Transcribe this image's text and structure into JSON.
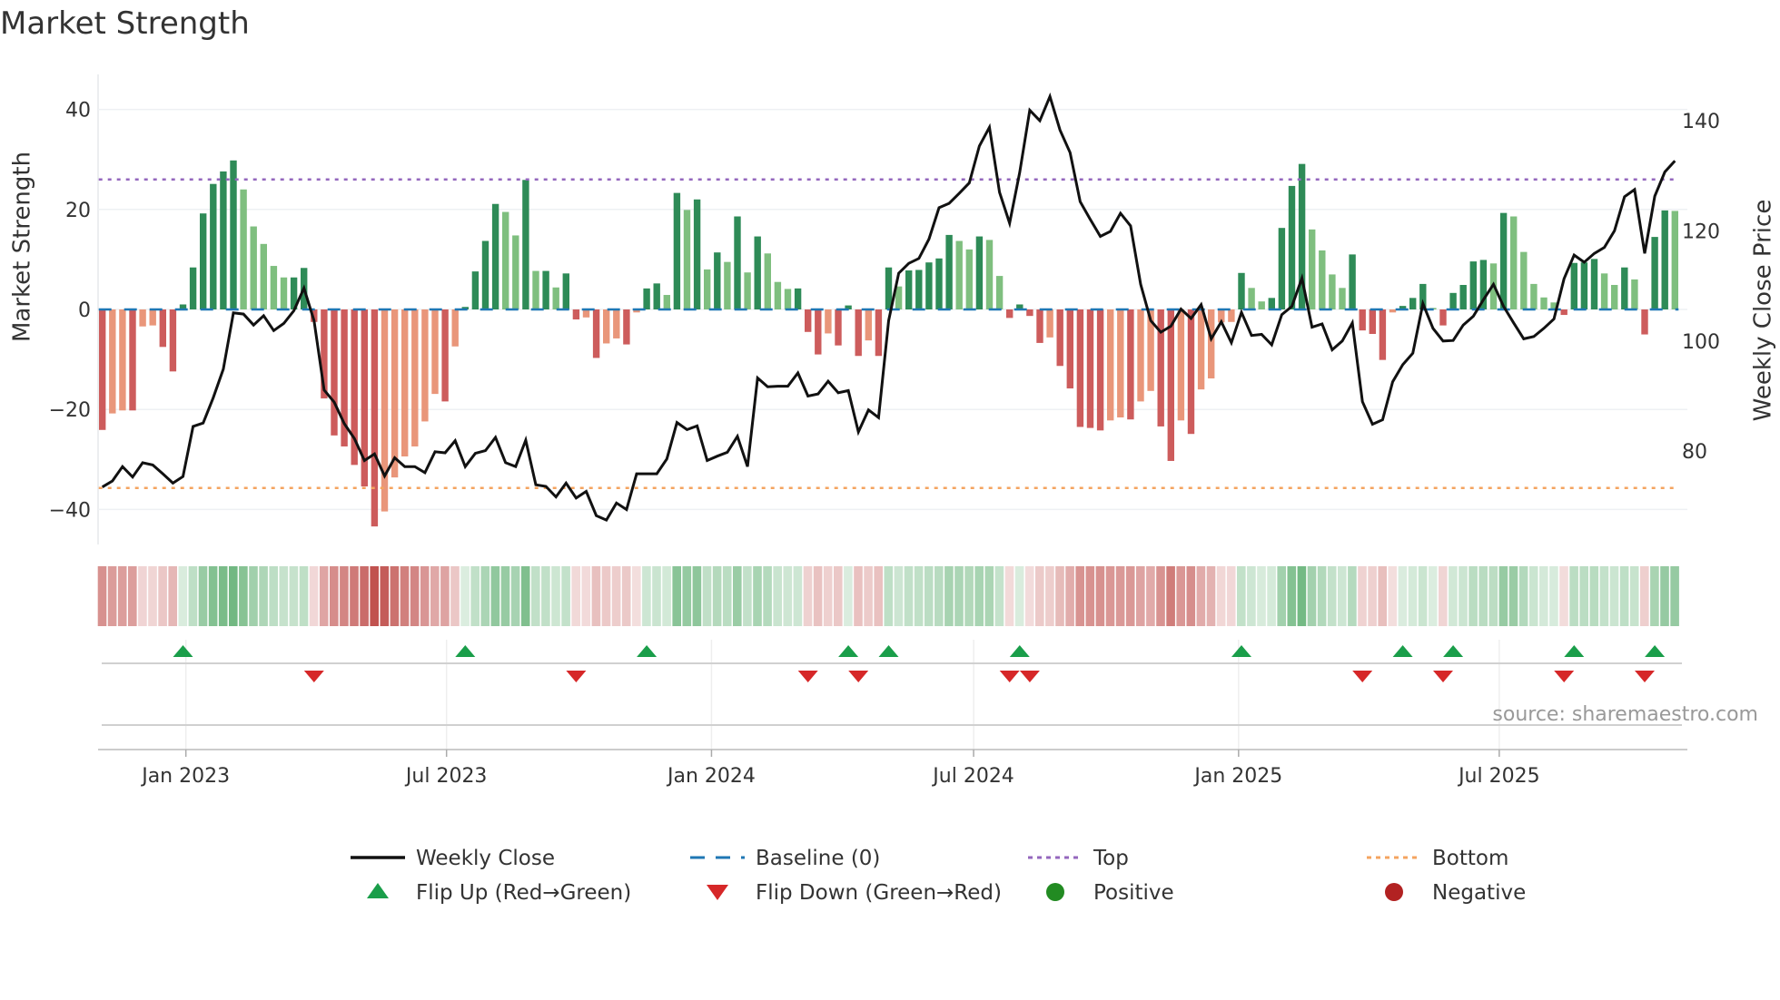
{
  "title": "Market Strength",
  "source": "source: sharemaestro.com",
  "chart_data": {
    "type": "bar+line",
    "title": "Market Strength",
    "start_week": "2022-11-04",
    "frequency": "weekly",
    "left_axis": {
      "label": "Market Strength",
      "ticks": [
        -40,
        -20,
        0,
        20,
        40
      ],
      "range": [
        -47,
        47
      ]
    },
    "right_axis": {
      "label": "Weekly Close Price",
      "ticks": [
        80,
        100,
        120,
        140
      ],
      "range": [
        63,
        148.4
      ]
    },
    "x_ticks": [
      {
        "label": "Jan 2023",
        "date": "2023-01-01"
      },
      {
        "label": "Jul 2023",
        "date": "2023-07-01"
      },
      {
        "label": "Jan 2024",
        "date": "2024-01-01"
      },
      {
        "label": "Jul 2024",
        "date": "2024-07-01"
      },
      {
        "label": "Jan 2025",
        "date": "2025-01-01"
      },
      {
        "label": "Jul 2025",
        "date": "2025-07-01"
      }
    ],
    "top_threshold": 26,
    "bottom_threshold": -35.7,
    "baseline": 0,
    "strength": [
      -24.1,
      -20.8,
      -20.2,
      -20.2,
      -3.4,
      -3.2,
      -7.5,
      -12.4,
      1.0,
      8.4,
      19.2,
      25.1,
      27.6,
      29.8,
      24.0,
      16.6,
      13.1,
      8.7,
      6.4,
      6.4,
      8.3,
      -2.5,
      -17.8,
      -25.2,
      -27.4,
      -31.1,
      -35.4,
      -43.4,
      -40.4,
      -33.6,
      -29.4,
      -27.4,
      -22.4,
      -16.9,
      -18.4,
      -7.4,
      0.5,
      7.6,
      13.7,
      21.1,
      19.5,
      14.8,
      25.9,
      7.7,
      7.7,
      4.4,
      7.2,
      -2.0,
      -1.6,
      -9.7,
      -6.8,
      -5.8,
      -7.0,
      -0.6,
      4.2,
      5.2,
      2.9,
      23.3,
      19.9,
      22.0,
      8.0,
      11.4,
      9.5,
      18.6,
      7.4,
      14.6,
      11.2,
      5.5,
      4.1,
      4.2,
      -4.5,
      -9.0,
      -4.8,
      -7.2,
      0.8,
      -9.3,
      -6.2,
      -9.3,
      8.4,
      4.6,
      7.8,
      7.9,
      9.4,
      10.2,
      14.9,
      13.7,
      12.0,
      14.6,
      13.9,
      6.7,
      -1.7,
      1.0,
      -1.3,
      -6.7,
      -5.6,
      -11.3,
      -15.8,
      -23.5,
      -23.7,
      -24.2,
      -22.2,
      -21.6,
      -22.0,
      -18.4,
      -16.3,
      -23.4,
      -30.3,
      -22.2,
      -24.9,
      -16.0,
      -13.8,
      -2.6,
      -2.5,
      7.3,
      4.3,
      1.6,
      2.3,
      16.3,
      24.7,
      29.1,
      16.0,
      11.8,
      7.0,
      4.3,
      11.0,
      -4.2,
      -4.9,
      -10.1,
      -0.6,
      0.7,
      2.3,
      5.1,
      0.3,
      -3.2,
      3.3,
      4.9,
      9.6,
      9.9,
      9.2,
      19.3,
      18.6,
      11.5,
      5.1,
      2.4,
      1.4,
      -1.1,
      9.3,
      9.4,
      10.1,
      7.2,
      4.9,
      8.4,
      6.0,
      -5.0,
      14.5,
      19.8,
      19.7
    ],
    "weekly_close": [
      73.5,
      74.6,
      77.2,
      75.3,
      77.9,
      77.5,
      75.9,
      74.2,
      75.4,
      84.5,
      85.1,
      89.7,
      94.9,
      105.1,
      104.9,
      102.9,
      104.6,
      101.9,
      103.2,
      105.5,
      109.6,
      103.7,
      91.1,
      88.9,
      85.0,
      82.3,
      78.3,
      79.5,
      75.5,
      78.8,
      77.2,
      77.2,
      76.1,
      79.9,
      79.7,
      81.9,
      77.2,
      79.6,
      80.1,
      82.5,
      77.9,
      77.2,
      82.0,
      73.9,
      73.6,
      71.7,
      74.2,
      71.5,
      72.7,
      68.3,
      67.5,
      70.6,
      69.4,
      75.9,
      75.9,
      75.9,
      78.6,
      85.2,
      83.9,
      84.6,
      78.3,
      79.1,
      79.8,
      82.7,
      77.2,
      93.3,
      91.7,
      91.8,
      91.8,
      94.2,
      90.0,
      90.4,
      92.7,
      90.6,
      91.0,
      83.5,
      87.5,
      86.1,
      103.7,
      112.3,
      114.1,
      115.0,
      118.5,
      124.2,
      125.0,
      126.8,
      128.7,
      135.4,
      138.8,
      127.0,
      121.4,
      130.6,
      141.9,
      140.0,
      144.4,
      138.3,
      134.2,
      125.3,
      122.1,
      119.0,
      119.9,
      123.2,
      120.9,
      110.3,
      103.7,
      101.6,
      102.7,
      105.8,
      104.1,
      106.6,
      100.4,
      103.5,
      99.7,
      105.2,
      101.0,
      101.2,
      99.3,
      104.8,
      106.3,
      111.4,
      102.5,
      103.1,
      98.4,
      100.0,
      103.3,
      89.0,
      84.9,
      85.7,
      92.6,
      95.7,
      97.8,
      106.8,
      102.3,
      100.0,
      100.1,
      102.9,
      104.5,
      107.5,
      110.3,
      106.3,
      103.3,
      100.4,
      100.8,
      102.3,
      104.0,
      111.3,
      115.6,
      114.3,
      115.9,
      117.0,
      120.0,
      126.2,
      127.5,
      115.9,
      126.3,
      130.7,
      132.7
    ],
    "flip_up_weeks": [
      8,
      36,
      54,
      74,
      78,
      91,
      113,
      129,
      134,
      146,
      154
    ],
    "flip_down_weeks": [
      21,
      47,
      70,
      75,
      90,
      92,
      125,
      133,
      145,
      153
    ],
    "legend": [
      {
        "label": "Weekly Close",
        "symbol": "solid-line"
      },
      {
        "label": "Baseline (0)",
        "symbol": "dashed-line"
      },
      {
        "label": "Top",
        "symbol": "dotted-line"
      },
      {
        "label": "Bottom",
        "symbol": "dotted-line"
      },
      {
        "label": "Flip Up (Red→Green)",
        "symbol": "triangle-up"
      },
      {
        "label": "Flip Down (Green→Red)",
        "symbol": "triangle-down"
      },
      {
        "label": "Positive",
        "symbol": "circle"
      },
      {
        "label": "Negative",
        "symbol": "circle"
      }
    ],
    "colors": {
      "pos_strong": "#2e8b57",
      "pos_weak": "#7fbf7f",
      "neg_strong": "#cd5c5c",
      "neg_weak": "#e9967a",
      "line": "#111111",
      "baseline": "#1f77b4",
      "top": "#9467bd",
      "bottom": "#f4a460",
      "flip_up": "#1a9e4a",
      "flip_down": "#d62728",
      "positive": "#228b22",
      "negative": "#b22222",
      "heat_pos": "#3f9f55",
      "heat_neg": "#c0504d"
    }
  }
}
